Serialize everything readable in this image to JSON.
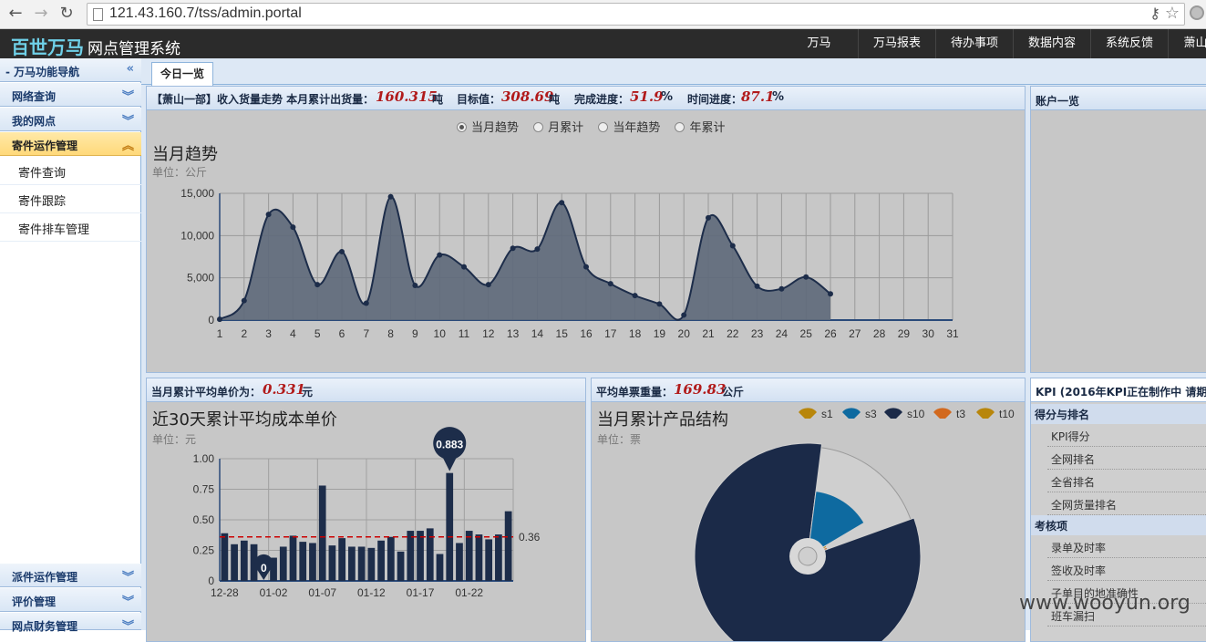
{
  "browser": {
    "url": "121.43.160.7/tss/admin.portal"
  },
  "header": {
    "logo": "百世万马",
    "system_name": "网点管理系统",
    "nav": [
      "万马",
      "万马报表",
      "待办事项",
      "数据内容",
      "系统反馈",
      "萧山"
    ]
  },
  "sidebar": {
    "title": "- 万马功能导航",
    "sections": [
      {
        "label": "网络查询",
        "expanded": false
      },
      {
        "label": "我的网点",
        "expanded": false
      },
      {
        "label": "寄件运作管理",
        "expanded": true,
        "items": [
          "寄件查询",
          "寄件跟踪",
          "寄件排车管理"
        ]
      }
    ],
    "bottom_sections": [
      "派件运作管理",
      "评价管理",
      "网点财务管理"
    ]
  },
  "tabs": [
    "今日一览"
  ],
  "trend_panel": {
    "header_prefix": "【萧山一部】收入货量走势 本月累计出货量：",
    "month_total": "160.315",
    "unit_ton": "吨",
    "target_label": "目标值：",
    "target": "308.69",
    "progress_label": "完成进度：",
    "progress": "51.9",
    "time_label": "时间进度：",
    "time_progress": "87.1",
    "percent": "%",
    "radios": [
      "当月趋势",
      "月累计",
      "当年趋势",
      "年累计"
    ],
    "selected_radio": 0,
    "title": "当月趋势",
    "unit": "单位：公斤"
  },
  "price_panel": {
    "header_label": "当月累计平均单价为：",
    "avg_price": "0.331",
    "currency": "元",
    "title": "近30天累计平均成本单价",
    "unit": "单位：元",
    "peak_label": "0.883",
    "min_label": "0",
    "ref_label": "0.36"
  },
  "product_panel": {
    "header_label": "平均单票重量：",
    "avg_weight": "169.83",
    "unit_kg": "公斤",
    "title": "当月累计产品结构",
    "unit": "单位：票",
    "legend": [
      "s1",
      "s3",
      "s10",
      "t3",
      "t10"
    ]
  },
  "account_panel": {
    "title": "账户一览"
  },
  "kpi_panel": {
    "title": "KPI (2016年KPI正在制作中 请期待",
    "groups": [
      {
        "label": "得分与排名",
        "rows": [
          "KPI得分",
          "全网排名",
          "全省排名",
          "全网货量排名"
        ]
      },
      {
        "label": "考核项",
        "rows": [
          "录单及时率",
          "签收及时率",
          "子单目的地准确性",
          "班车漏扫"
        ]
      }
    ]
  },
  "watermark": "www.wooyun.org",
  "chart_data": [
    {
      "type": "area",
      "title": "当月趋势",
      "ylabel": "单位：公斤",
      "x": [
        1,
        2,
        3,
        4,
        5,
        6,
        7,
        8,
        9,
        10,
        11,
        12,
        13,
        14,
        15,
        16,
        17,
        18,
        19,
        20,
        21,
        22,
        23,
        24,
        25,
        26,
        27,
        28,
        29,
        30,
        31
      ],
      "values": [
        100,
        2300,
        12500,
        11000,
        4200,
        8100,
        2000,
        14600,
        4100,
        7700,
        6300,
        4200,
        8500,
        8400,
        13900,
        6300,
        4300,
        2900,
        1900,
        600,
        12100,
        8800,
        4000,
        3700,
        5100,
        3100,
        null,
        null,
        null,
        null,
        null
      ],
      "ylim": [
        0,
        15000
      ],
      "yticks": [
        "0",
        "5,000",
        "10,000",
        "15,000"
      ],
      "grid": true,
      "color": "#1d2d4a",
      "fill": "#5f6a7b"
    },
    {
      "type": "bar",
      "title": "近30天累计平均成本单价",
      "ylabel": "单位：元",
      "values": [
        0.39,
        0.3,
        0.33,
        0.3,
        0.0,
        0.19,
        0.28,
        0.37,
        0.32,
        0.31,
        0.78,
        0.29,
        0.35,
        0.28,
        0.28,
        0.27,
        0.33,
        0.36,
        0.24,
        0.41,
        0.41,
        0.43,
        0.22,
        0.883,
        0.31,
        0.41,
        0.38,
        0.34,
        0.38,
        0.57
      ],
      "xticks": [
        "12-28",
        "01-02",
        "01-07",
        "01-12",
        "01-17",
        "01-22"
      ],
      "yticks": [
        "0",
        "0.25",
        "0.50",
        "0.75",
        "1.00"
      ],
      "ylim": [
        0,
        1
      ],
      "reference_line": 0.36,
      "color": "#1d2d4a"
    },
    {
      "type": "pie",
      "title": "当月累计产品结构",
      "ylabel": "单位：票",
      "series": [
        {
          "name": "s10",
          "value": 82.5,
          "color": "#1b2a48"
        },
        {
          "name": "s3",
          "value": 14.5,
          "color": "#0e6aa0"
        },
        {
          "name": "s1",
          "value": 1.5,
          "color": "#b8860b"
        },
        {
          "name": "t3",
          "value": 1.5,
          "color": "#d2691e"
        }
      ]
    }
  ]
}
